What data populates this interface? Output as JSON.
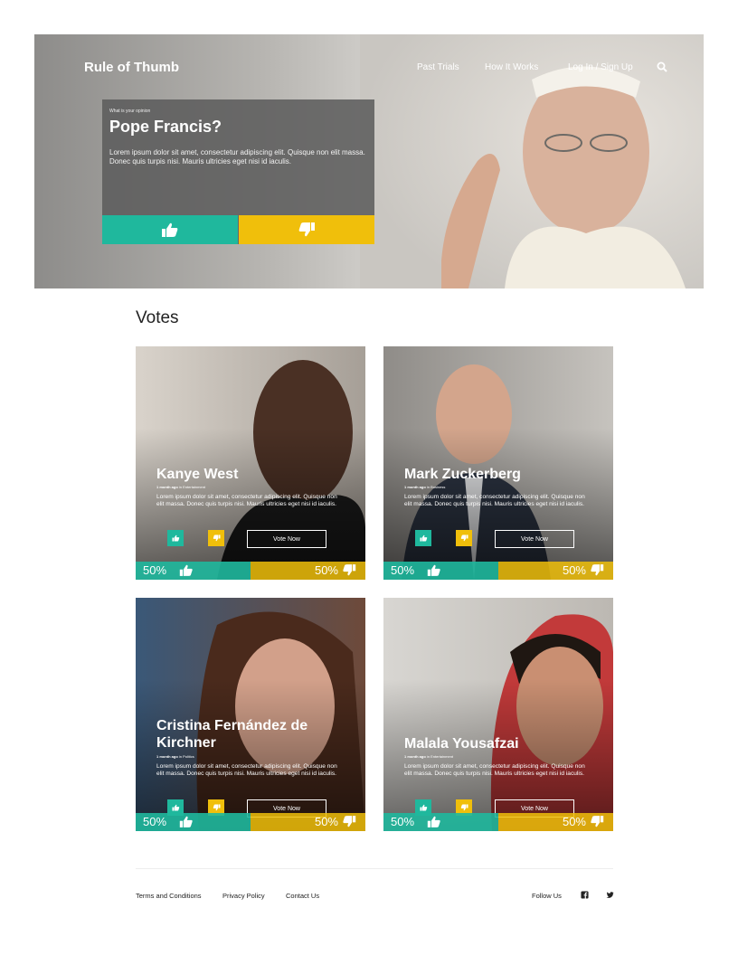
{
  "nav": {
    "brand": "Rule of Thumb",
    "links": [
      "Past Trials",
      "How It Works",
      "Log In / Sign Up"
    ],
    "search_icon": "search-icon"
  },
  "hero": {
    "kicker": "What is your opinion",
    "title": "Pope Francis?",
    "description": "Lorem ipsum dolor sit amet, consectetur adipiscing elit. Quisque non elit massa. Donec quis turpis nisi. Mauris ultricies eget nisi id iaculis.",
    "icons": [
      "thumbs-up-icon",
      "thumbs-down-icon"
    ]
  },
  "votes": {
    "title": "Votes",
    "cards": [
      {
        "name": "Kanye West",
        "meta_ago": "1 month ago",
        "meta_category": "in Entertainment",
        "description": "Lorem ipsum dolor sit amet, consectetur adipiscing elit. Quisque non elit massa. Donec quis turpis nisi. Mauris ultricies eget nisi id iaculis.",
        "vote_label": "Vote Now",
        "up_pct": "50%",
        "down_pct": "50%",
        "up_share": 0.5
      },
      {
        "name": "Mark Zuckerberg",
        "meta_ago": "1 month ago",
        "meta_category": "in Business",
        "description": "Lorem ipsum dolor sit amet, consectetur adipiscing elit. Quisque non elit massa. Donec quis turpis nisi. Mauris ultricies eget nisi id iaculis.",
        "vote_label": "Vote Now",
        "up_pct": "50%",
        "down_pct": "50%",
        "up_share": 0.5
      },
      {
        "name": "Cristina Fernández de Kirchner",
        "meta_ago": "1 month ago",
        "meta_category": "in Politics",
        "description": "Lorem ipsum dolor sit amet, consectetur adipiscing elit. Quisque non elit massa. Donec quis turpis nisi. Mauris ultricies eget nisi id iaculis.",
        "vote_label": "Vote Now",
        "up_pct": "50%",
        "down_pct": "50%",
        "up_share": 0.5
      },
      {
        "name": "Malala Yousafzai",
        "meta_ago": "1 month ago",
        "meta_category": "in Entertainment",
        "description": "Lorem ipsum dolor sit amet, consectetur adipiscing elit. Quisque non elit massa. Donec quis turpis nisi. Mauris ultricies eget nisi id iaculis.",
        "vote_label": "Vote Now",
        "up_pct": "50%",
        "down_pct": "50%",
        "up_share": 0.5
      }
    ]
  },
  "footer": {
    "links": [
      "Terms and Conditions",
      "Privacy Policy",
      "Contact Us"
    ],
    "follow_label": "Follow Us",
    "social_icons": [
      "facebook-icon",
      "twitter-icon"
    ]
  },
  "colors": {
    "up": "#1fb89d",
    "down": "#f0bf0b"
  }
}
